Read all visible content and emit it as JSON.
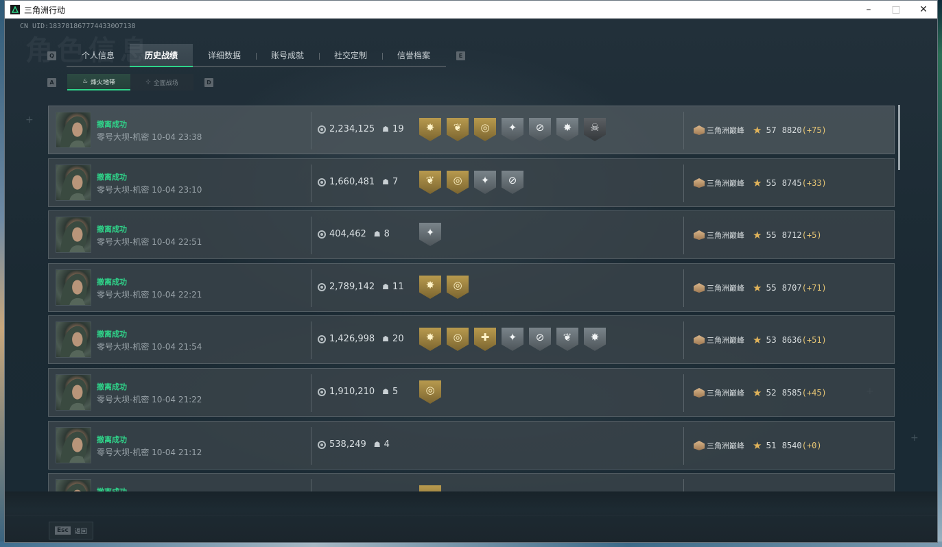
{
  "window": {
    "title": "三角洲行动",
    "minimize_glyph": "–",
    "maximize_glyph": "□",
    "close_glyph": "✕"
  },
  "header": {
    "uid": "CN UID:1837818677744330O7138",
    "watermark": "角色信息",
    "left_key": "Q",
    "right_key": "E",
    "sub_left_key": "A",
    "sub_right_key": "D"
  },
  "tabs": [
    {
      "label": "个人信息",
      "active": false
    },
    {
      "label": "历史战绩",
      "active": true
    },
    {
      "label": "详细数据",
      "active": false
    },
    {
      "label": "账号成就",
      "active": false
    },
    {
      "label": "社交定制",
      "active": false
    },
    {
      "label": "信誉档案",
      "active": false
    }
  ],
  "subtabs": [
    {
      "label": "烽火地带",
      "icon": "flame-icon",
      "active": true
    },
    {
      "label": "全面战场",
      "icon": "crosshair-icon",
      "active": false
    }
  ],
  "records": [
    {
      "status": "撤离成功",
      "map": "零号大坝-机密 10-04 23:38",
      "money": "2,234,125",
      "kills": "19",
      "badges": [
        {
          "type": "gold",
          "icon": "burst-icon"
        },
        {
          "type": "gold",
          "icon": "wreath-icon"
        },
        {
          "type": "gold",
          "icon": "target-icon"
        },
        {
          "type": "grey",
          "icon": "shield-star-icon"
        },
        {
          "type": "grey",
          "icon": "crossed-icon"
        },
        {
          "type": "grey",
          "icon": "burst-icon"
        },
        {
          "type": "dark",
          "icon": "skull-icon"
        }
      ],
      "rank": "三角洲巅峰",
      "level": "57",
      "score": "8820",
      "delta": "(+75)"
    },
    {
      "status": "撤离成功",
      "map": "零号大坝-机密 10-04 23:10",
      "money": "1,660,481",
      "kills": "7",
      "badges": [
        {
          "type": "gold",
          "icon": "wreath-icon"
        },
        {
          "type": "gold",
          "icon": "target-icon"
        },
        {
          "type": "grey",
          "icon": "shield-star-icon"
        },
        {
          "type": "grey",
          "icon": "crossed-icon"
        }
      ],
      "rank": "三角洲巅峰",
      "level": "55",
      "score": "8745",
      "delta": "(+33)"
    },
    {
      "status": "撤离成功",
      "map": "零号大坝-机密 10-04 22:51",
      "money": "404,462",
      "kills": "8",
      "badges": [
        {
          "type": "grey",
          "icon": "shield-star-icon"
        }
      ],
      "rank": "三角洲巅峰",
      "level": "55",
      "score": "8712",
      "delta": "(+5)"
    },
    {
      "status": "撤离成功",
      "map": "零号大坝-机密 10-04 22:21",
      "money": "2,789,142",
      "kills": "11",
      "badges": [
        {
          "type": "gold",
          "icon": "burst-icon"
        },
        {
          "type": "gold",
          "icon": "target-icon"
        }
      ],
      "rank": "三角洲巅峰",
      "level": "55",
      "score": "8707",
      "delta": "(+71)"
    },
    {
      "status": "撤离成功",
      "map": "零号大坝-机密 10-04 21:54",
      "money": "1,426,998",
      "kills": "20",
      "badges": [
        {
          "type": "gold",
          "icon": "burst-icon"
        },
        {
          "type": "gold",
          "icon": "target-icon"
        },
        {
          "type": "gold",
          "icon": "beetle-icon"
        },
        {
          "type": "grey",
          "icon": "shield-star-icon"
        },
        {
          "type": "grey",
          "icon": "crossed-icon"
        },
        {
          "type": "grey",
          "icon": "wreath-icon"
        },
        {
          "type": "grey",
          "icon": "burst-icon"
        }
      ],
      "rank": "三角洲巅峰",
      "level": "53",
      "score": "8636",
      "delta": "(+51)"
    },
    {
      "status": "撤离成功",
      "map": "零号大坝-机密 10-04 21:22",
      "money": "1,910,210",
      "kills": "5",
      "badges": [
        {
          "type": "gold",
          "icon": "target-icon"
        }
      ],
      "rank": "三角洲巅峰",
      "level": "52",
      "score": "8585",
      "delta": "(+45)"
    },
    {
      "status": "撤离成功",
      "map": "零号大坝-机密 10-04 21:12",
      "money": "538,249",
      "kills": "4",
      "badges": [],
      "rank": "三角洲巅峰",
      "level": "51",
      "score": "8540",
      "delta": "(+0)"
    },
    {
      "status": "撤离成功",
      "map": "",
      "money": "",
      "kills": "",
      "badges": [
        {
          "type": "gold",
          "icon": "target-icon"
        }
      ],
      "rank": "",
      "level": "",
      "score": "",
      "delta": ""
    }
  ],
  "footer": {
    "esc_key": "Esc",
    "esc_label": "返回"
  },
  "colors": {
    "accent": "#2fd58a",
    "delta": "#e6c574",
    "badge_gold": "#b89a4e",
    "badge_grey": "#7a848a"
  }
}
